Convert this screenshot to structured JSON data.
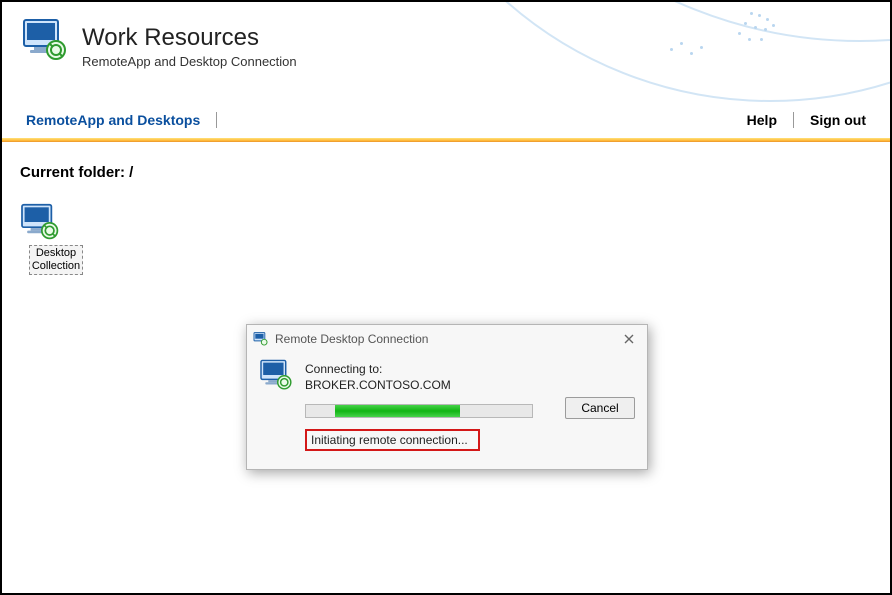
{
  "header": {
    "title": "Work Resources",
    "subtitle": "RemoteApp and Desktop Connection"
  },
  "nav": {
    "primary": "RemoteApp and Desktops",
    "help": "Help",
    "signout": "Sign out"
  },
  "content": {
    "folder_label": "Current folder: /",
    "items": [
      {
        "label": "Desktop\nCollection"
      }
    ]
  },
  "dialog": {
    "title": "Remote Desktop Connection",
    "connecting_label": "Connecting to:",
    "host": "BROKER.CONTOSO.COM",
    "cancel": "Cancel",
    "status": "Initiating remote connection...",
    "progress_percent": 55
  }
}
